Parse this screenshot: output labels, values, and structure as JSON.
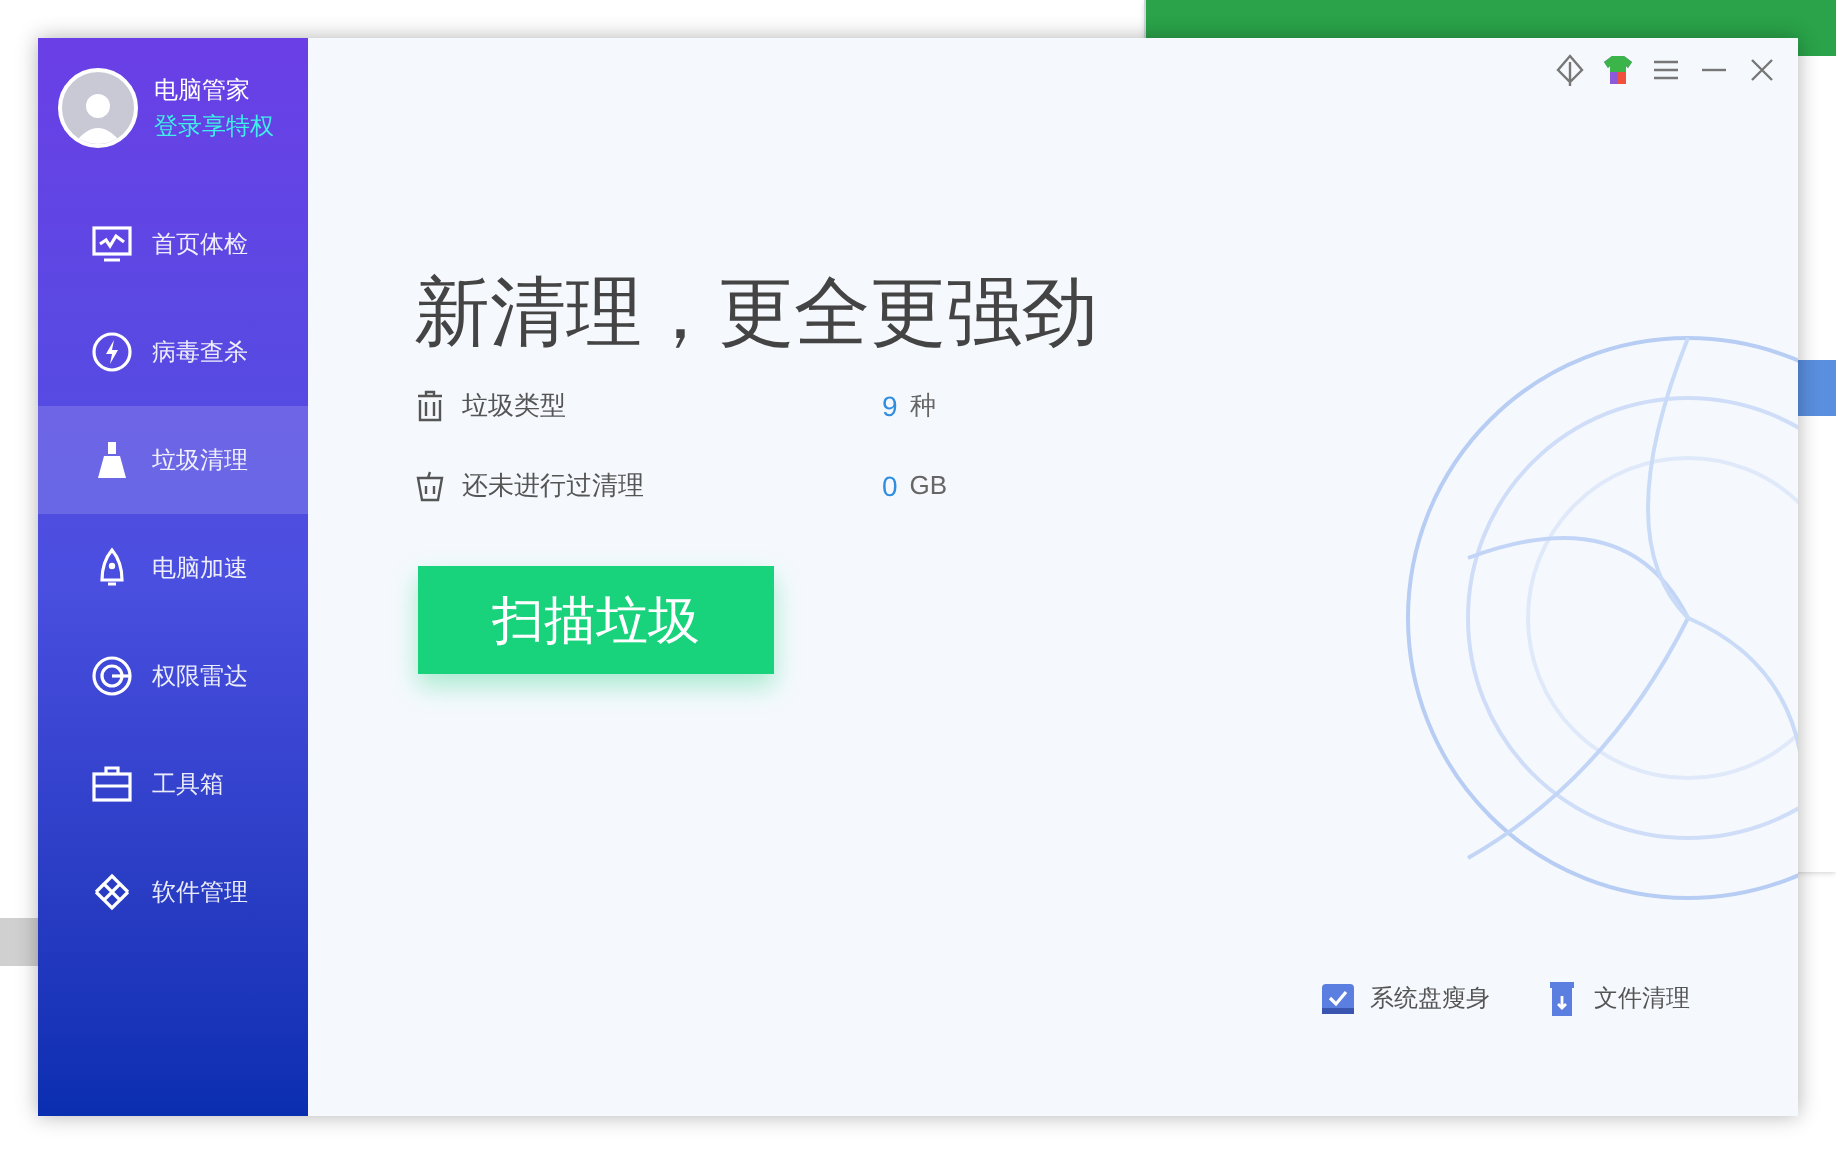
{
  "user": {
    "name": "电脑管家",
    "login_link": "登录享特权"
  },
  "sidebar": {
    "items": [
      {
        "label": "首页体检",
        "selected": false
      },
      {
        "label": "病毒查杀",
        "selected": false
      },
      {
        "label": "垃圾清理",
        "selected": true
      },
      {
        "label": "电脑加速",
        "selected": false
      },
      {
        "label": "权限雷达",
        "selected": false
      },
      {
        "label": "工具箱",
        "selected": false
      },
      {
        "label": "软件管理",
        "selected": false
      }
    ]
  },
  "main": {
    "headline": "新清理，更全更强劲",
    "stats": [
      {
        "label": "垃圾类型",
        "value": "9",
        "unit": "种"
      },
      {
        "label": "还未进行过清理",
        "value": "0",
        "unit": "GB"
      }
    ],
    "scan_button": "扫描垃圾",
    "tools": [
      {
        "label": "系统盘瘦身"
      },
      {
        "label": "文件清理"
      }
    ]
  }
}
